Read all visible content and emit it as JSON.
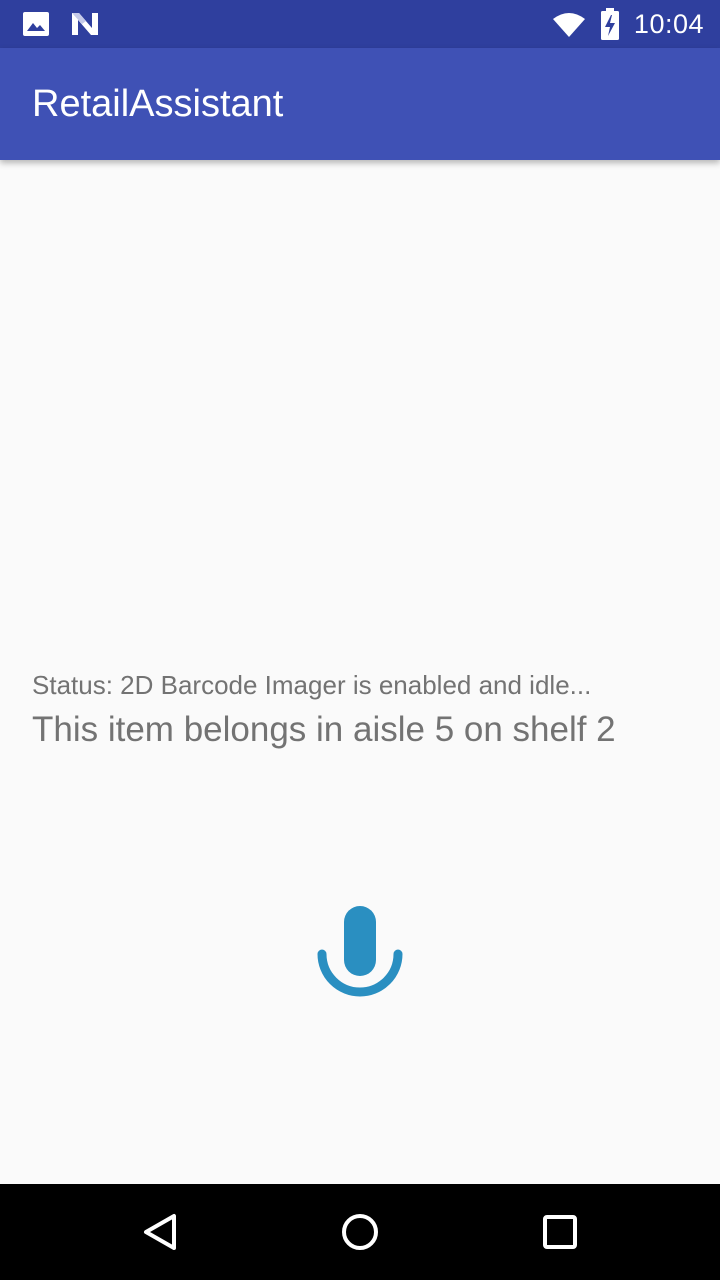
{
  "status_bar": {
    "time": "10:04",
    "left_icons": [
      "gallery-icon",
      "n-logo-icon"
    ],
    "right_icons": [
      "wifi-icon",
      "battery-charging-icon"
    ],
    "background": "#2f3f9e"
  },
  "app_bar": {
    "title": "RetailAssistant",
    "background": "#3f51b5"
  },
  "main": {
    "status_message": "Status: 2D Barcode Imager is enabled and idle...",
    "result_message": "This item belongs in aisle 5 on shelf 2",
    "mic_icon": "microphone-icon",
    "mic_color": "#2a8fc1",
    "text_color": "#737373"
  },
  "nav_bar": {
    "buttons": [
      "back-icon",
      "home-icon",
      "recents-icon"
    ]
  }
}
